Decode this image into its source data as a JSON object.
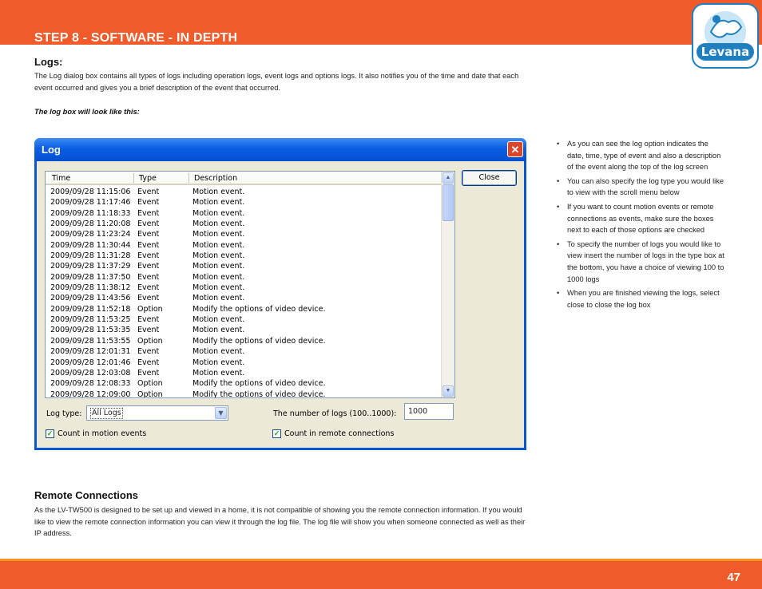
{
  "header": {
    "title": "STEP 8  - SOFTWARE - IN DEPTH"
  },
  "logo": {
    "text": "Levana"
  },
  "logs_section": {
    "heading": "Logs:",
    "body": "The Log dialog box contains all types of logs including operation logs, event logs and options logs. It also notifies you of the time and date that each event occurred and gives you a brief description of the event that occurred.",
    "caption": "The log box will look like this:"
  },
  "dialog": {
    "title": "Log",
    "close_glyph": "✕",
    "columns": [
      "Time",
      "Type",
      "Description"
    ],
    "rows": [
      [
        "2009/09/28 11:15:06",
        "Event",
        "Motion event."
      ],
      [
        "2009/09/28 11:17:46",
        "Event",
        "Motion event."
      ],
      [
        "2009/09/28 11:18:33",
        "Event",
        "Motion event."
      ],
      [
        "2009/09/28 11:20:08",
        "Event",
        "Motion event."
      ],
      [
        "2009/09/28 11:23:24",
        "Event",
        "Motion event."
      ],
      [
        "2009/09/28 11:30:44",
        "Event",
        "Motion event."
      ],
      [
        "2009/09/28 11:31:28",
        "Event",
        "Motion event."
      ],
      [
        "2009/09/28 11:37:29",
        "Event",
        "Motion event."
      ],
      [
        "2009/09/28 11:37:50",
        "Event",
        "Motion event."
      ],
      [
        "2009/09/28 11:38:12",
        "Event",
        "Motion event."
      ],
      [
        "2009/09/28 11:43:56",
        "Event",
        "Motion event."
      ],
      [
        "2009/09/28 11:52:18",
        "Option",
        "Modify the options of video device."
      ],
      [
        "2009/09/28 11:53:25",
        "Event",
        "Motion event."
      ],
      [
        "2009/09/28 11:53:35",
        "Event",
        "Motion event."
      ],
      [
        "2009/09/28 11:53:55",
        "Option",
        "Modify the options of video device."
      ],
      [
        "2009/09/28 12:01:31",
        "Event",
        "Motion event."
      ],
      [
        "2009/09/28 12:01:46",
        "Event",
        "Motion event."
      ],
      [
        "2009/09/28 12:03:08",
        "Event",
        "Motion event."
      ],
      [
        "2009/09/28 12:08:33",
        "Option",
        "Modify the options of video device."
      ],
      [
        "2009/09/28 12:09:00",
        "Option",
        "Modify the options of video device."
      ]
    ],
    "close_button": "Close",
    "log_type_label": "Log type:",
    "log_type_value": "All Logs",
    "num_logs_label": "The number of logs (100..1000):",
    "num_logs_value": "1000",
    "chk_motion_label": "Count in motion events",
    "chk_remote_label": "Count in remote connections",
    "chk_motion_checked": true,
    "chk_remote_checked": true
  },
  "bullets": [
    "As you can see the log option indicates the date, time, type of event and also a description of the event along the top of the log screen",
    "You can also specify the log type you would like to view with the scroll menu below",
    "If you want to count motion events or remote connections as events, make sure the boxes next to each of those options are checked",
    "To specify the number of logs you would like to view insert the number of logs in the type box at the bottom, you have a choice of viewing 100 to 1000 logs",
    "When you are finished viewing the logs, select close to close the log box"
  ],
  "remote_section": {
    "heading": "Remote Connections",
    "body": "As the LV-TW500 is designed to be set up and viewed in a home, it is not compatible of showing you the remote connection information. If you would like to view the remote connection information you can view it through the log file. The log file will show you when someone connected as well as their IP address."
  },
  "footer": {
    "page_number": "47"
  },
  "colors": {
    "brand_orange": "#f15a29",
    "accent_orange": "#f7941d",
    "xp_blue": "#0a55d6"
  }
}
